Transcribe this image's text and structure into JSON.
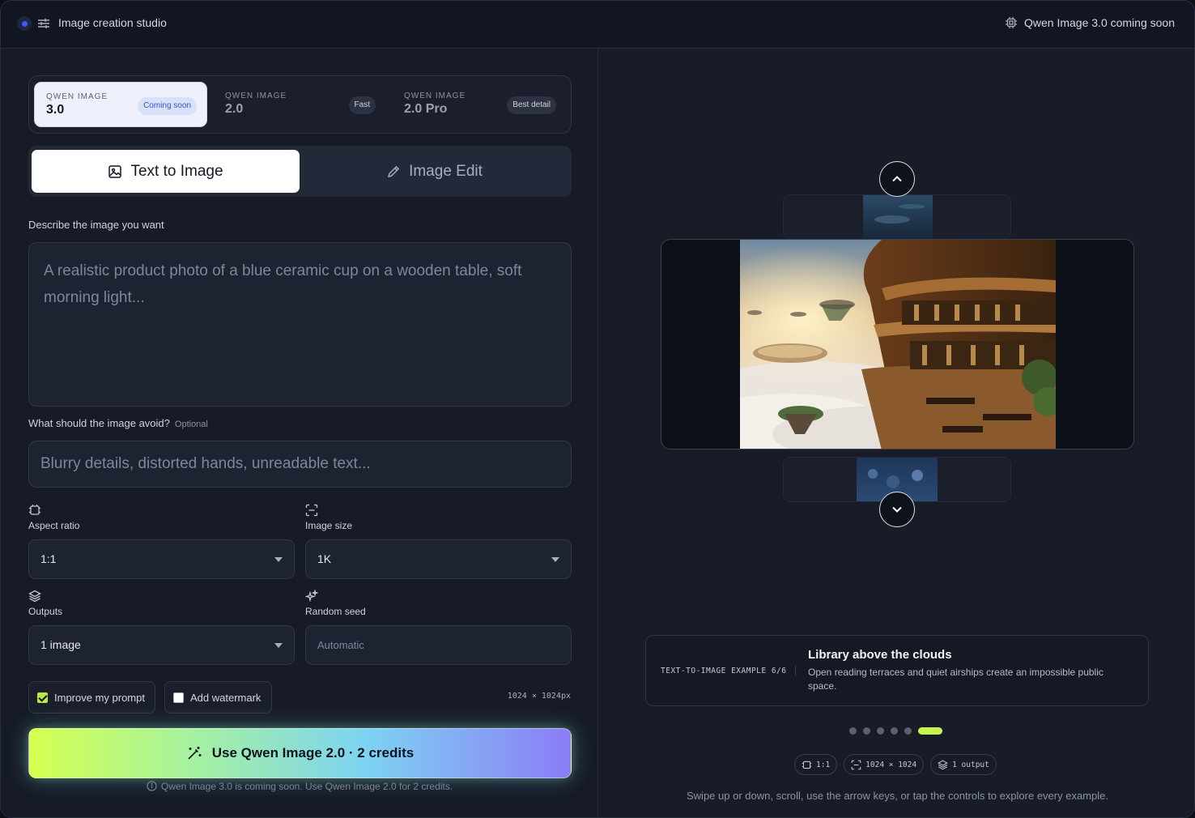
{
  "header": {
    "title": "Image creation studio",
    "notice": "Qwen Image 3.0 coming soon"
  },
  "models": [
    {
      "kicker": "QWEN IMAGE",
      "name": "3.0",
      "badge": "Coming soon",
      "active": true
    },
    {
      "kicker": "QWEN IMAGE",
      "name": "2.0",
      "badge": "Fast",
      "active": false
    },
    {
      "kicker": "QWEN IMAGE",
      "name": "2.0 Pro",
      "badge": "Best detail",
      "active": false
    }
  ],
  "modes": [
    {
      "label": "Text to Image",
      "active": true
    },
    {
      "label": "Image Edit",
      "active": false
    }
  ],
  "prompt": {
    "label": "Describe the image you want",
    "placeholder": "A realistic product photo of a blue ceramic cup on a wooden table, soft morning light..."
  },
  "negative": {
    "label": "What should the image avoid?",
    "optional": "Optional",
    "placeholder": "Blurry details, distorted hands, unreadable text..."
  },
  "settings": {
    "aspect_ratio": {
      "label": "Aspect ratio",
      "value": "1:1"
    },
    "image_size": {
      "label": "Image size",
      "value": "1K"
    },
    "outputs": {
      "label": "Outputs",
      "value": "1 image"
    },
    "seed": {
      "label": "Random seed",
      "placeholder": "Automatic"
    }
  },
  "options": {
    "improve_prompt": {
      "label": "Improve my prompt",
      "checked": true
    },
    "watermark": {
      "label": "Add watermark",
      "checked": false
    },
    "dimensions": "1024 × 1024px"
  },
  "cta": {
    "label": "Use Qwen Image 2.0 · 2 credits",
    "note": "Qwen Image 3.0 is coming soon. Use Qwen Image 2.0 for 2 credits."
  },
  "showcase": {
    "kicker": "TEXT-TO-IMAGE EXAMPLE 6/6",
    "title": "Library above the clouds",
    "description": "Open reading terraces and quiet airships create an impossible public space.",
    "page_count": 6,
    "active_page": 6,
    "meta": {
      "ratio": "1:1",
      "size": "1024 × 1024",
      "outputs": "1 output"
    },
    "help": "Swipe up or down, scroll, use the arrow keys, or tap the controls to explore every example."
  },
  "colors": {
    "accent": "#c6f34d",
    "active_model_bg": "#eef1fb",
    "coming_soon_badge": "#3a55c8"
  }
}
